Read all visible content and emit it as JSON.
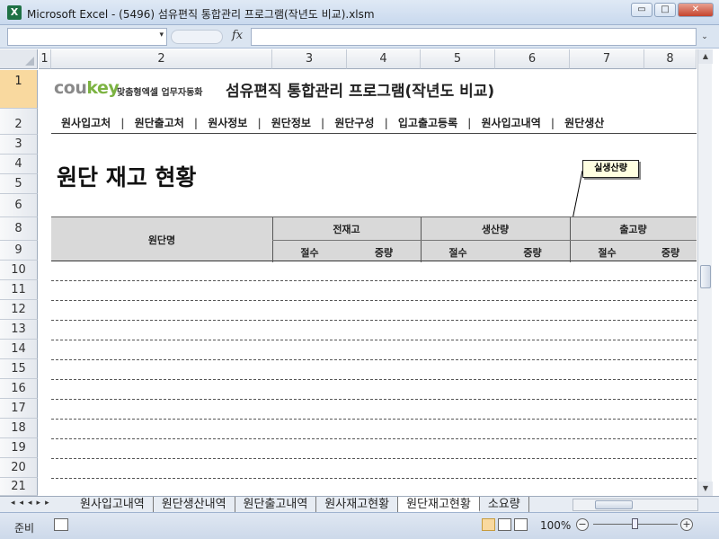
{
  "window": {
    "app_icon": "X",
    "title": "Microsoft Excel - (5496) 섬유편직 통합관리 프로그램(작년도 비교).xlsm",
    "buttons": [
      "▭",
      "□",
      "✕"
    ]
  },
  "formula_bar": {
    "fx": "fx",
    "namebox_arrow": "▾",
    "expand": "⌄"
  },
  "columns": [
    "1",
    "2",
    "3",
    "4",
    "5",
    "6",
    "7",
    "8"
  ],
  "rows": [
    "1",
    "2",
    "3",
    "4",
    "5",
    "6",
    "8",
    "9",
    "10",
    "11",
    "12",
    "13",
    "14",
    "15",
    "16",
    "17",
    "18",
    "19",
    "20",
    "21"
  ],
  "header": {
    "logo_grey": "cou",
    "logo_green": "key",
    "logo_sub": "맞춤형엑셀 업무자동화",
    "app_title": "섬유편직 통합관리 프로그램(작년도 비교)"
  },
  "nav": {
    "items": [
      "원사입고처",
      "원단출고처",
      "원사정보",
      "원단정보",
      "원단구성",
      "입고출고등록",
      "원사입고내역",
      "원단생산"
    ],
    "separator": "|"
  },
  "page_heading": "원단 재고 현황",
  "comment_note": "실생산량",
  "table": {
    "col_name": "원단명",
    "groups": [
      "전재고",
      "생산량",
      "출고량"
    ],
    "sub_headers": [
      "절수",
      "중량",
      "절수",
      "중량",
      "절수",
      "중량"
    ]
  },
  "sheet_tabs": {
    "nav": "◂◂◂▸▸",
    "tabs": [
      "원사입고내역",
      "원단생산내역",
      "원단출고내역",
      "원사재고현황",
      "원단재고현황",
      "소요량"
    ],
    "active_index": 4
  },
  "status": {
    "ready": "준비",
    "zoom": "100%",
    "zoom_minus": "−",
    "zoom_plus": "+"
  }
}
